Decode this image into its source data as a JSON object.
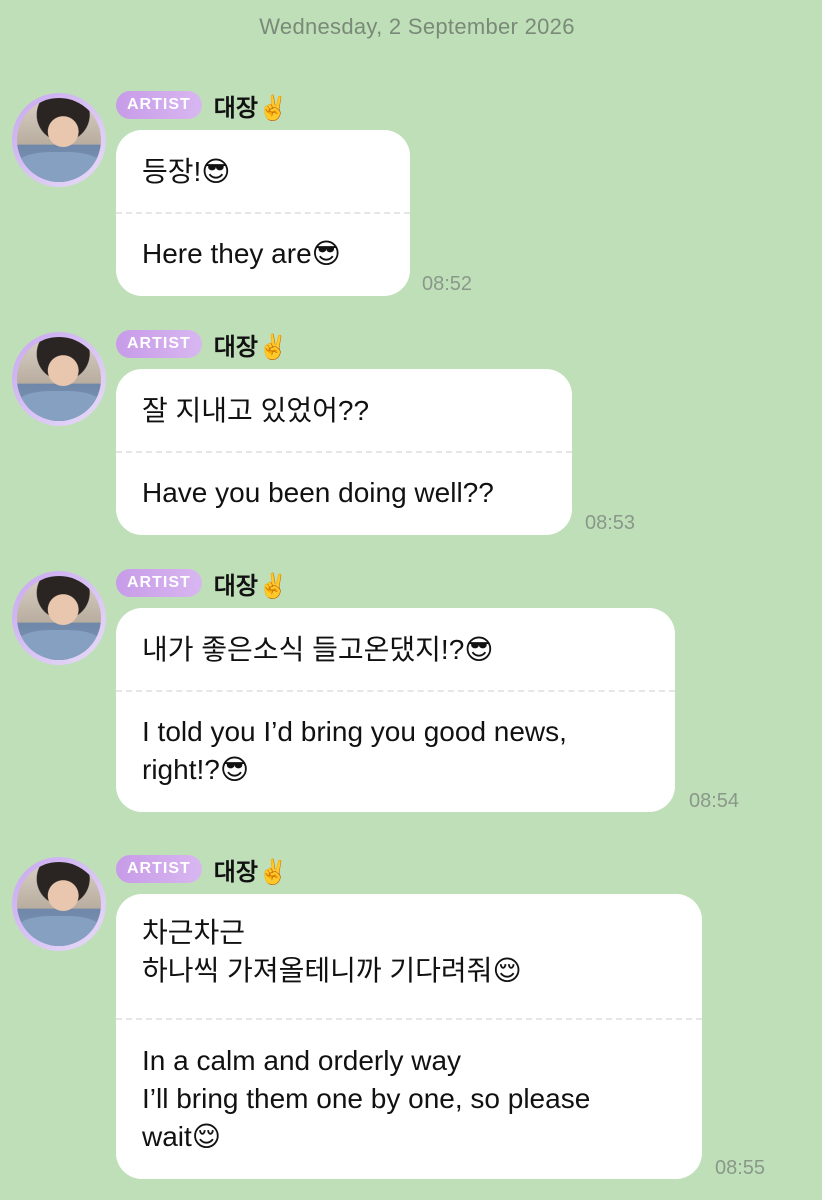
{
  "date_header": "Wednesday, 2 September 2026",
  "messages": [
    {
      "badge": "ARTIST",
      "sender": "대장✌️",
      "original": "등장!😎",
      "translation": "Here they are😎",
      "time": "08:52"
    },
    {
      "badge": "ARTIST",
      "sender": "대장✌️",
      "original": "잘 지내고 있었어??",
      "translation": "Have you been doing well??",
      "time": "08:53"
    },
    {
      "badge": "ARTIST",
      "sender": "대장✌️",
      "original": "내가 좋은소식 들고온댔지!?😎",
      "translation": "I told you I’d bring you good news,\nright!?😎",
      "time": "08:54"
    },
    {
      "badge": "ARTIST",
      "sender": "대장✌️",
      "original": "차근차근\n하나씩 가져올테니까 기다려줘😌",
      "translation": "In a calm and orderly way\nI’ll bring them one by one, so please\nwait😌",
      "time": "08:55"
    }
  ]
}
